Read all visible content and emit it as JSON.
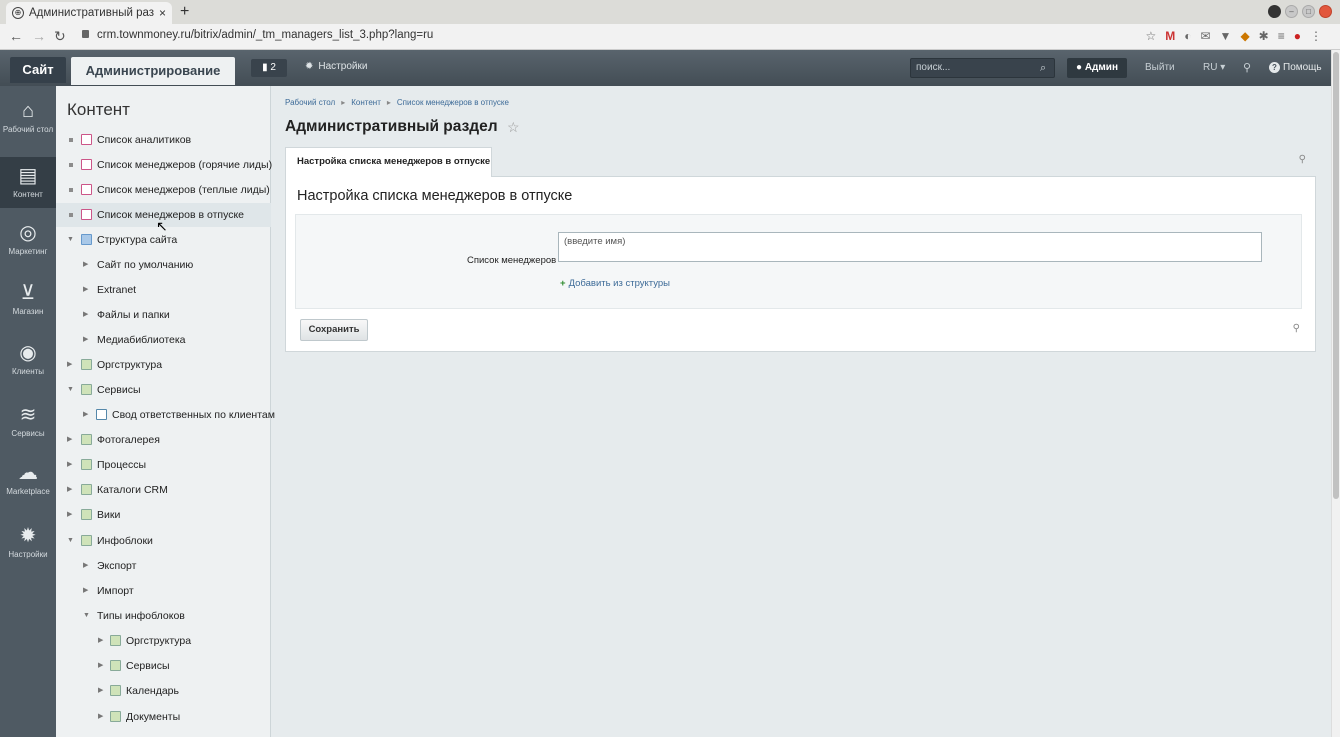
{
  "browser": {
    "tab_title": "Административный раз",
    "tab_close": "×",
    "new_tab": "+",
    "url": "crm.townmoney.ru/bitrix/admin/_tm_managers_list_3.php?lang=ru"
  },
  "topbar": {
    "site": "Сайт",
    "admin": "Администрирование",
    "notifications": "2",
    "settings": "Настройки",
    "search_placeholder": "поиск...",
    "user": "Админ",
    "logout": "Выйти",
    "lang": "RU",
    "help": "Помощь"
  },
  "iconbar": [
    {
      "label": "Рабочий стол",
      "icon": "home-icon"
    },
    {
      "label": "Контент",
      "icon": "document-icon",
      "active": true
    },
    {
      "label": "Маркетинг",
      "icon": "target-icon"
    },
    {
      "label": "Магазин",
      "icon": "basket-icon"
    },
    {
      "label": "Клиенты",
      "icon": "clients-icon"
    },
    {
      "label": "Сервисы",
      "icon": "layers-icon"
    },
    {
      "label": "Marketplace",
      "icon": "cloud-download-icon"
    },
    {
      "label": "Настройки",
      "icon": "gear-icon"
    }
  ],
  "menu": {
    "title": "Контент",
    "items": [
      {
        "label": "Список аналитиков"
      },
      {
        "label": "Список менеджеров (горячие лиды)"
      },
      {
        "label": "Список менеджеров (теплые лиды)"
      },
      {
        "label": "Список менеджеров в отпуске"
      },
      {
        "label": "Структура сайта"
      },
      {
        "label": "Сайт по умолчанию"
      },
      {
        "label": "Extranet"
      },
      {
        "label": "Файлы и папки"
      },
      {
        "label": "Медиабиблиотека"
      },
      {
        "label": "Оргструктура"
      },
      {
        "label": "Сервисы"
      },
      {
        "label": "Свод ответственных по клиентам"
      },
      {
        "label": "Фотогалерея"
      },
      {
        "label": "Процессы"
      },
      {
        "label": "Каталоги CRM"
      },
      {
        "label": "Вики"
      },
      {
        "label": "Инфоблоки"
      },
      {
        "label": "Экспорт"
      },
      {
        "label": "Импорт"
      },
      {
        "label": "Типы инфоблоков"
      },
      {
        "label": "Оргструктура"
      },
      {
        "label": "Сервисы"
      },
      {
        "label": "Календарь"
      },
      {
        "label": "Документы"
      }
    ]
  },
  "breadcrumbs": [
    "Рабочий стол",
    "Контент",
    "Список менеджеров в отпуске"
  ],
  "page_title": "Административный раздел",
  "tab_label": "Настройка списка менеджеров в отпуске",
  "form": {
    "title": "Настройка списка менеджеров в отпуске",
    "field_label": "Список менеджеров",
    "field_placeholder": "(введите имя)",
    "add_link": "Добавить из структуры",
    "save": "Сохранить"
  }
}
